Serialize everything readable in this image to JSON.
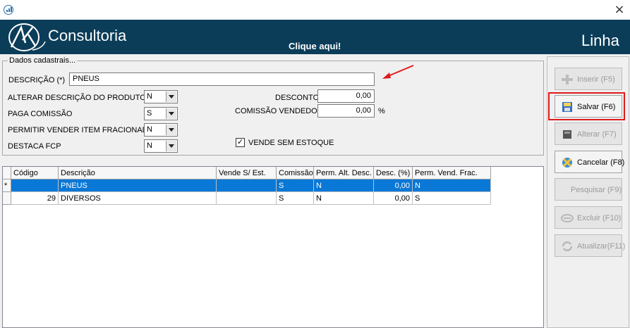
{
  "banner": {
    "brand": "Consultoria",
    "link": "Clique aqui!",
    "title": "Linha"
  },
  "form": {
    "section_label": "Dados cadastrais...",
    "descricao_label": "DESCRIÇÃO (*)",
    "descricao_value": "PNEUS",
    "alterar_label": "ALTERAR DESCRIÇÃO DO PRODUTO",
    "alterar_value": "N",
    "paga_label": "PAGA COMISSÃO",
    "paga_value": "S",
    "fracionado_label": "PERMITIR VENDER ITEM FRACIONADO",
    "fracionado_value": "N",
    "fcp_label": "DESTACA FCP",
    "fcp_value": "N",
    "desconto_label": "DESCONTO",
    "desconto_value": "0,00",
    "comissao_label": "COMISSÃO VENDEDOR",
    "comissao_value": "0,00",
    "percent": "%",
    "estoque_label": "VENDE SEM ESTOQUE",
    "estoque_checked": true,
    "checkmark": "✓"
  },
  "grid": {
    "headers": [
      "Código",
      "Descrição",
      "Vende S/ Est.",
      "Comissão",
      "Perm. Alt. Desc.",
      "Desc. (%)",
      "Perm. Vend. Frac."
    ],
    "rows": [
      {
        "indicator": "*",
        "cells": [
          "",
          "PNEUS",
          "",
          "S",
          "N",
          "0,00",
          "N"
        ],
        "selected": true
      },
      {
        "indicator": "",
        "cells": [
          "29",
          "DIVERSOS",
          "",
          "S",
          "N",
          "0,00",
          "S"
        ],
        "selected": false
      }
    ]
  },
  "buttons": {
    "inserir": "Inserir (F5)",
    "salvar": "Salvar (F6)",
    "alterar": "Alterar (F7)",
    "cancelar": "Cancelar (F8)",
    "pesquisar": "Pesquisar (F9)",
    "excluir": "Excluir (F10)",
    "atualizar": "Atualizar(F11)"
  },
  "icons": [
    "app-icon",
    "close-icon",
    "logo-icon",
    "arrow-annotation",
    "add-icon",
    "save-icon",
    "edit-icon",
    "cancel-icon",
    "delete-icon",
    "refresh-icon"
  ],
  "colors": {
    "banner": "#0b3d59",
    "selection": "#0a78d7",
    "annotation": "#e01b1b"
  }
}
